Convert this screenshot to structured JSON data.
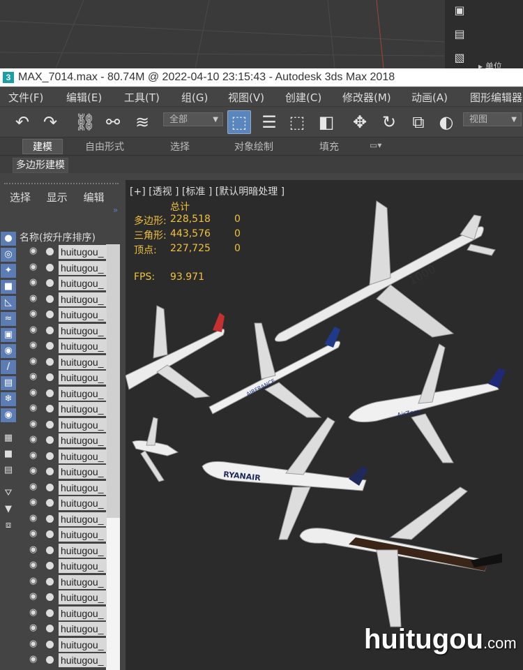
{
  "window": {
    "title": "MAX_7014.max - 80.74M @ 2022-04-10 23:15:43 - Autodesk 3ds Max 2018",
    "logo_char": "3"
  },
  "background": {
    "unit_label": "单位"
  },
  "menu": [
    "文件(F)",
    "编辑(E)",
    "工具(T)",
    "组(G)",
    "视图(V)",
    "创建(C)",
    "修改器(M)",
    "动画(A)",
    "图形编辑器"
  ],
  "toolbar": {
    "selection_filter": "全部",
    "ref_coord": "视图"
  },
  "ribbon": {
    "tabs": [
      "建模",
      "自由形式",
      "选择",
      "对象绘制",
      "填充"
    ],
    "active_tab": "建模",
    "sub_panel": "多边形建模"
  },
  "scene_explorer": {
    "menu": [
      "选择",
      "显示",
      "编辑"
    ],
    "header": "名称(按升序排序)",
    "rows": [
      "huitugou_",
      "huitugou_",
      "huitugou_",
      "huitugou_",
      "huitugou_",
      "huitugou_",
      "huitugou_",
      "huitugou_",
      "huitugou_",
      "huitugou_",
      "huitugou_",
      "huitugou_",
      "huitugou_",
      "huitugou_",
      "huitugou_",
      "huitugou_",
      "huitugou_",
      "huitugou_",
      "huitugou_",
      "huitugou_",
      "huitugou_",
      "huitugou_",
      "huitugou_",
      "huitugou_",
      "huitugou_",
      "huitugou_",
      "huitugou_"
    ]
  },
  "viewport": {
    "label": "[+] [透视 ] [标准 ] [默认明暗处理 ]",
    "stats_header": "总计",
    "stats": [
      {
        "label": "多边形:",
        "value": "228,518",
        "sel": "0"
      },
      {
        "label": "三角形:",
        "value": "443,576",
        "sel": "0"
      },
      {
        "label": "顶点:",
        "value": "227,725",
        "sel": "0"
      }
    ],
    "fps_label": "FPS:",
    "fps_value": "93.971",
    "plane_liveries": [
      "1000",
      "AIRFRANCE",
      "AirZero",
      "RYANAIR"
    ],
    "watermark": "huitugou",
    "watermark_suffix": ".com",
    "colors": {
      "stats_text": "#f2c23a",
      "active_blue": "#5a86c0"
    }
  }
}
